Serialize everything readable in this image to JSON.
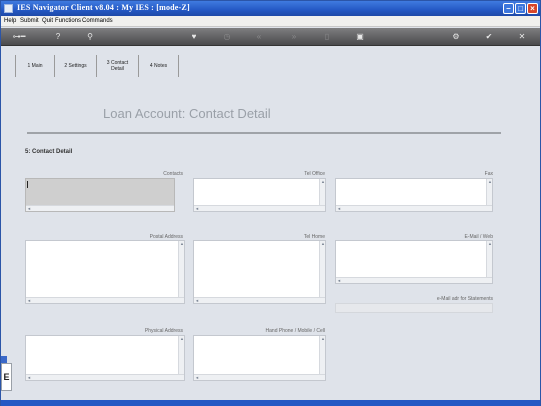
{
  "window": {
    "title": "IES Navigator Client v8.04 : My IES :       [mode-Z]"
  },
  "menu": {
    "items": [
      "Help",
      "Submit",
      "Quit",
      "Functions",
      "Commands"
    ]
  },
  "toolbar": {
    "icons": [
      "key-icon",
      "help-icon",
      "search-icon",
      "heart-icon",
      "clock-icon",
      "rewind-icon",
      "fast-forward-icon",
      "page-icon",
      "clear-icon",
      "settings-icon",
      "check-icon",
      "close-icon"
    ]
  },
  "tabs": [
    {
      "label": "1 Main"
    },
    {
      "label": "2 Settings"
    },
    {
      "label_line1": "3 Contact",
      "label_line2": "Detail"
    },
    {
      "label": "4 Notes"
    }
  ],
  "page": {
    "heading": "Loan Account: Contact Detail",
    "section_title": "5: Contact Detail"
  },
  "fields": {
    "contacts": "Contacts",
    "tel_office": "Tel Office",
    "fax": "Fax",
    "postal_address": "Postal Address",
    "tel_home": "Tel Home",
    "email_web": "E-Mail / Web",
    "email_statements": "e-Mail adr for Statements",
    "physical_address": "Physical Address",
    "hand_phone": "Hand Phone / Mobile / Cell"
  },
  "side_tag": "E"
}
